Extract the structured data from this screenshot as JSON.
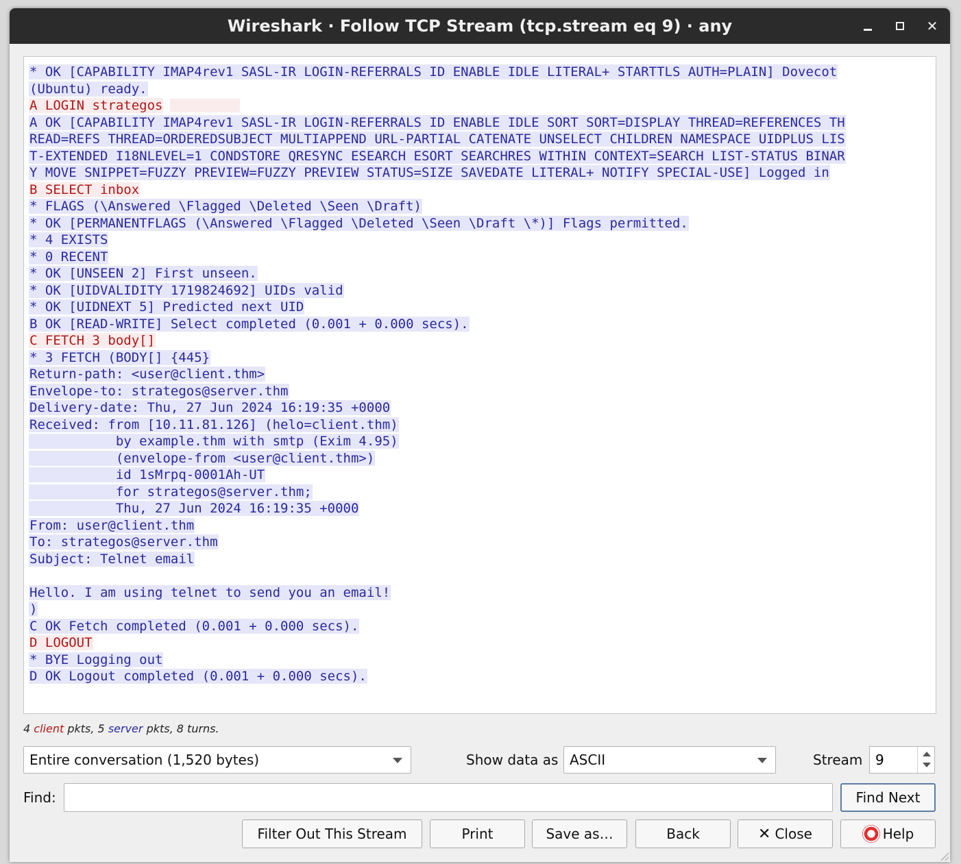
{
  "window": {
    "title": "Wireshark · Follow TCP Stream (tcp.stream eq 9) · any"
  },
  "colors": {
    "server_fg": "#2a2a9c",
    "server_bg": "#e6e6fa",
    "client_fg": "#b01818",
    "client_bg": "#faecec"
  },
  "stream_lines": [
    {
      "dir": "server",
      "text": "* OK [CAPABILITY IMAP4rev1 SASL-IR LOGIN-REFERRALS ID ENABLE IDLE LITERAL+ STARTTLS AUTH=PLAIN] Dovecot"
    },
    {
      "dir": "server",
      "text": "(Ubuntu) ready."
    },
    {
      "dir": "client",
      "text": "A LOGIN strategos",
      "redacted": true
    },
    {
      "dir": "server",
      "text": "A OK [CAPABILITY IMAP4rev1 SASL-IR LOGIN-REFERRALS ID ENABLE IDLE SORT SORT=DISPLAY THREAD=REFERENCES TH"
    },
    {
      "dir": "server",
      "text": "READ=REFS THREAD=ORDEREDSUBJECT MULTIAPPEND URL-PARTIAL CATENATE UNSELECT CHILDREN NAMESPACE UIDPLUS LIS"
    },
    {
      "dir": "server",
      "text": "T-EXTENDED I18NLEVEL=1 CONDSTORE QRESYNC ESEARCH ESORT SEARCHRES WITHIN CONTEXT=SEARCH LIST-STATUS BINAR"
    },
    {
      "dir": "server",
      "text": "Y MOVE SNIPPET=FUZZY PREVIEW=FUZZY PREVIEW STATUS=SIZE SAVEDATE LITERAL+ NOTIFY SPECIAL-USE] Logged in"
    },
    {
      "dir": "client",
      "text": "B SELECT inbox"
    },
    {
      "dir": "server",
      "text": "* FLAGS (\\Answered \\Flagged \\Deleted \\Seen \\Draft)"
    },
    {
      "dir": "server",
      "text": "* OK [PERMANENTFLAGS (\\Answered \\Flagged \\Deleted \\Seen \\Draft \\*)] Flags permitted."
    },
    {
      "dir": "server",
      "text": "* 4 EXISTS"
    },
    {
      "dir": "server",
      "text": "* 0 RECENT"
    },
    {
      "dir": "server",
      "text": "* OK [UNSEEN 2] First unseen."
    },
    {
      "dir": "server",
      "text": "* OK [UIDVALIDITY 1719824692] UIDs valid"
    },
    {
      "dir": "server",
      "text": "* OK [UIDNEXT 5] Predicted next UID"
    },
    {
      "dir": "server",
      "text": "B OK [READ-WRITE] Select completed (0.001 + 0.000 secs)."
    },
    {
      "dir": "client",
      "text": "C FETCH 3 body[]"
    },
    {
      "dir": "server",
      "text": "* 3 FETCH (BODY[] {445}"
    },
    {
      "dir": "server",
      "text": "Return-path: <user@client.thm>"
    },
    {
      "dir": "server",
      "text": "Envelope-to: strategos@server.thm"
    },
    {
      "dir": "server",
      "text": "Delivery-date: Thu, 27 Jun 2024 16:19:35 +0000"
    },
    {
      "dir": "server",
      "text": "Received: from [10.11.81.126] (helo=client.thm)"
    },
    {
      "dir": "server",
      "text": "           by example.thm with smtp (Exim 4.95)"
    },
    {
      "dir": "server",
      "text": "           (envelope-from <user@client.thm>)"
    },
    {
      "dir": "server",
      "text": "           id 1sMrpq-0001Ah-UT"
    },
    {
      "dir": "server",
      "text": "           for strategos@server.thm;"
    },
    {
      "dir": "server",
      "text": "           Thu, 27 Jun 2024 16:19:35 +0000"
    },
    {
      "dir": "server",
      "text": "From: user@client.thm"
    },
    {
      "dir": "server",
      "text": "To: strategos@server.thm"
    },
    {
      "dir": "server",
      "text": "Subject: Telnet email"
    },
    {
      "dir": "blank",
      "text": ""
    },
    {
      "dir": "server",
      "text": "Hello. I am using telnet to send you an email!"
    },
    {
      "dir": "server",
      "text": ")"
    },
    {
      "dir": "server",
      "text": "C OK Fetch completed (0.001 + 0.000 secs)."
    },
    {
      "dir": "client",
      "text": "D LOGOUT"
    },
    {
      "dir": "server",
      "text": "* BYE Logging out"
    },
    {
      "dir": "server",
      "text": "D OK Logout completed (0.001 + 0.000 secs)."
    }
  ],
  "summary": {
    "client_count": "4",
    "client_word": "client",
    "pkts1": "pkts,",
    "server_count": "5",
    "server_word": "server",
    "tail": "pkts, 8 turns."
  },
  "controls": {
    "conversation_value": "Entire conversation (1,520 bytes)",
    "show_data_label": "Show data as",
    "show_data_value": "ASCII",
    "stream_label": "Stream",
    "stream_value": "9",
    "find_label": "Find:",
    "find_value": "",
    "find_next_label": "Find Next"
  },
  "buttons": {
    "filter_out": "Filter Out This Stream",
    "print": "Print",
    "save_as": "Save as…",
    "back": "Back",
    "close": "Close",
    "help": "Help"
  }
}
